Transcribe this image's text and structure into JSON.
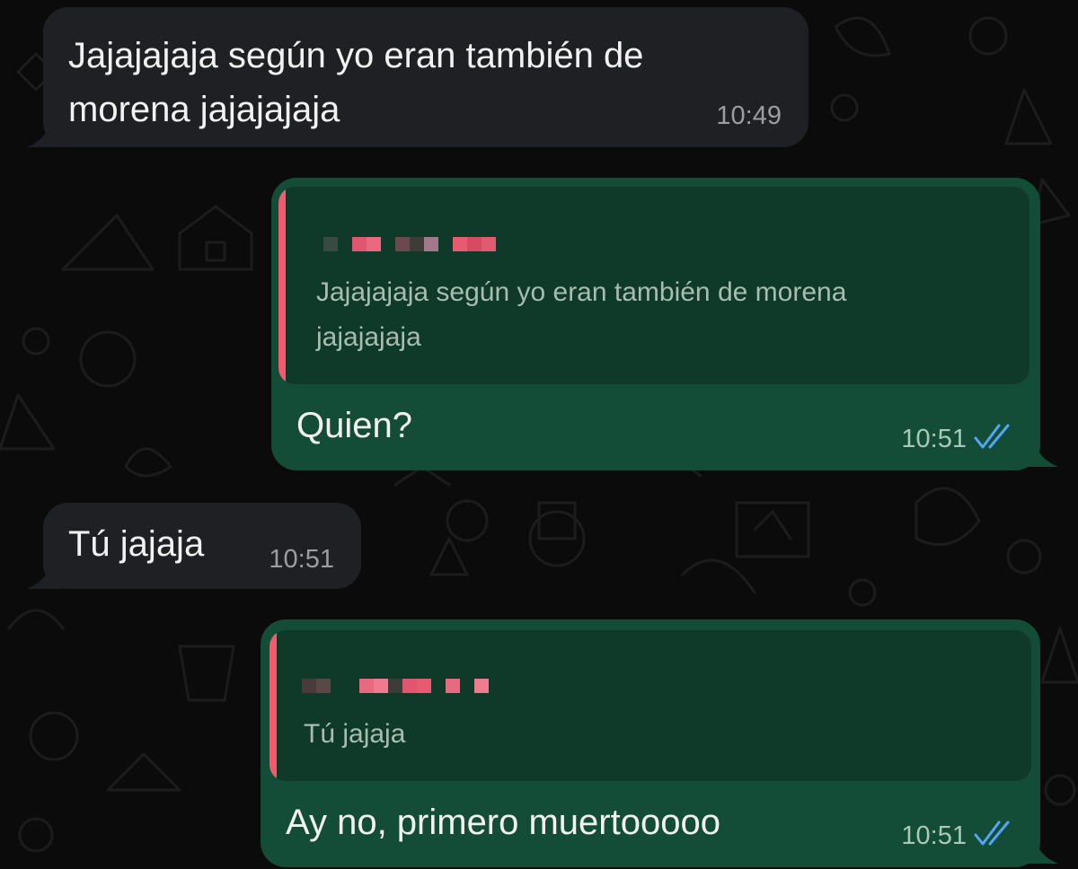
{
  "colors": {
    "background": "#0b0b0b",
    "incoming_bubble": "#1f2023",
    "outgoing_bubble": "#144d37",
    "quote_background": "#0f3a29",
    "quote_bar": "#f05b6d",
    "read_ticks": "#53a6f5"
  },
  "messages": [
    {
      "direction": "incoming",
      "lines": [
        "Jajajajaja según yo eran también de",
        "morena jajajajaja"
      ],
      "time": "10:49"
    },
    {
      "direction": "outgoing",
      "quote": {
        "sender": "",
        "lines": [
          "Jajajajaja según yo eran también de morena",
          "jajajajaja"
        ]
      },
      "text": "Quien?",
      "time": "10:51",
      "status_icon": "double-check-read-icon"
    },
    {
      "direction": "incoming",
      "text": "Tú jajaja",
      "time": "10:51"
    },
    {
      "direction": "outgoing",
      "quote": {
        "sender": "",
        "text": "Tú jajaja"
      },
      "text": "Ay no, primero muertooooo",
      "time": "10:51",
      "status_icon": "double-check-read-icon"
    }
  ]
}
